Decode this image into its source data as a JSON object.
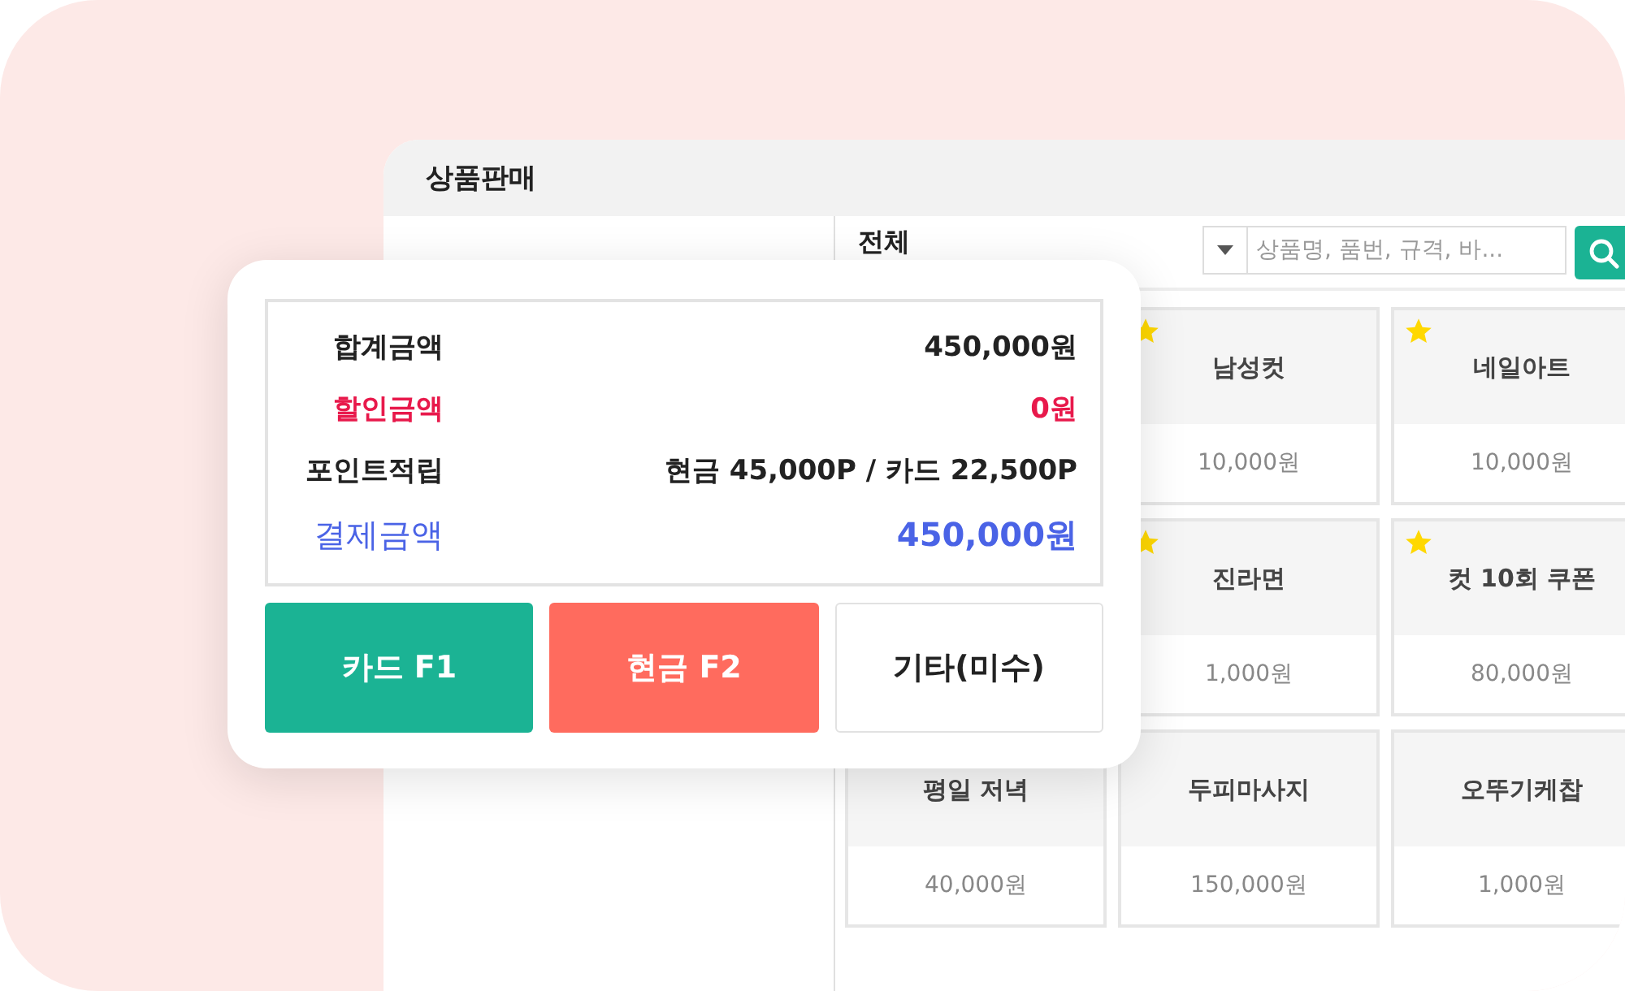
{
  "window": {
    "title": "상품판매"
  },
  "category": {
    "label": "전체"
  },
  "search": {
    "placeholder": "상품명, 품번, 규격, 바..."
  },
  "product_rows": [
    [
      {
        "name": "남성컷",
        "price": "10,000원",
        "starred": true
      },
      {
        "name": "네일아트",
        "price": "10,000원",
        "starred": true
      }
    ],
    [
      {
        "name": "진라면",
        "price": "1,000원",
        "starred": true
      },
      {
        "name": "컷 10회 쿠폰",
        "price": "80,000원",
        "starred": true
      }
    ],
    [
      {
        "name": "평일 저녁",
        "price": "40,000원",
        "starred": false
      },
      {
        "name": "두피마사지",
        "price": "150,000원",
        "starred": false
      },
      {
        "name": "오뚜기케찹",
        "price": "1,000원",
        "starred": false
      }
    ]
  ],
  "summary": [
    {
      "kind": "total",
      "label": "합계금액",
      "value": "450,000원"
    },
    {
      "kind": "discount",
      "label": "할인금액",
      "value": "0원"
    },
    {
      "kind": "points",
      "label": "포인트적립",
      "value": "현금 45,000P / 카드 22,500P"
    },
    {
      "kind": "payment",
      "label": "결제금액",
      "value": "450,000원"
    }
  ],
  "pay_buttons": [
    {
      "kind": "card",
      "label": "카드 F1"
    },
    {
      "kind": "cash",
      "label": "현금 F2"
    },
    {
      "kind": "other",
      "label": "기타(미수)"
    }
  ]
}
